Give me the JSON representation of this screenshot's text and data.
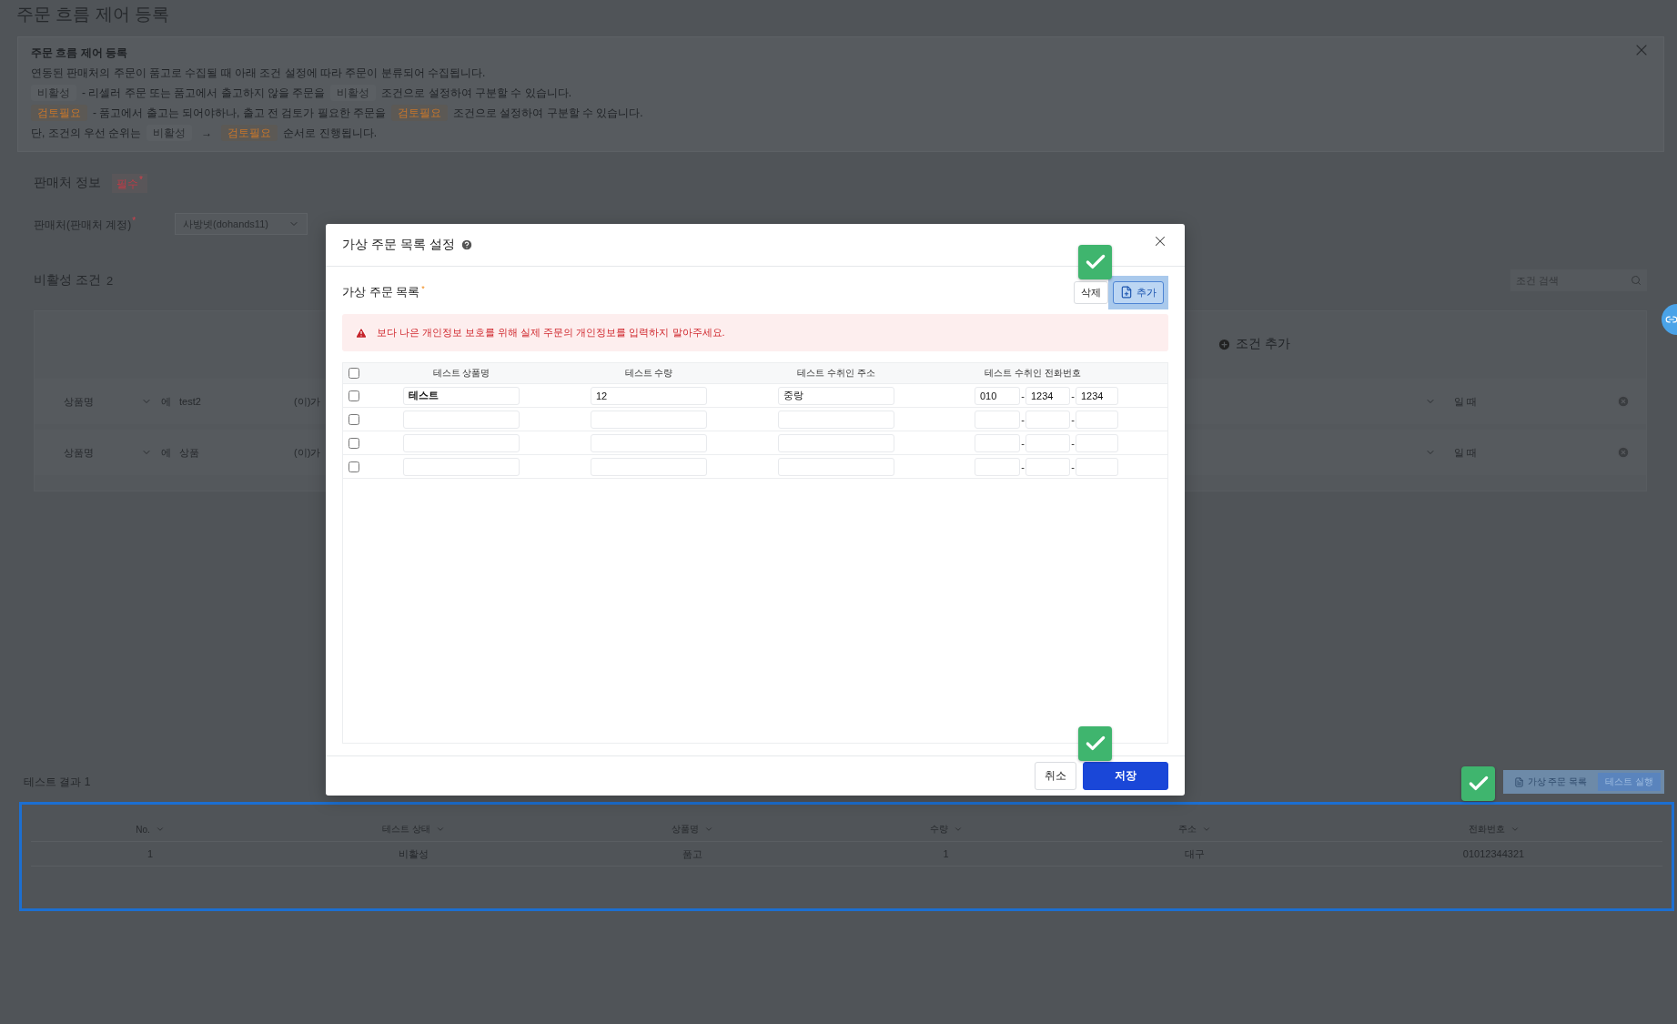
{
  "page": {
    "title": "주문 흐름 제어 등록"
  },
  "notice": {
    "title": "주문 흐름 제어 등록",
    "lines": [
      {
        "segments": [
          {
            "kind": "plain",
            "text": "연동된 판매처의 주문이 품고로 수집될 때 아래 조건 설정에 따라 주문이 분류되어 수집됩니다."
          }
        ]
      },
      {
        "segments": [
          {
            "kind": "inactive",
            "text": "비활성"
          },
          {
            "kind": "plain",
            "text": "- 리셀러 주문 또는 품고에서 출고하지 않을 주문을"
          },
          {
            "kind": "inactive",
            "text": "비활성"
          },
          {
            "kind": "plain",
            "text": "조건으로 설정하여 구분할 수 있습니다."
          }
        ]
      },
      {
        "segments": [
          {
            "kind": "review",
            "text": "검토필요"
          },
          {
            "kind": "plain",
            "text": "- 품고에서 출고는 되어야하나, 출고 전 검토가 필요한 주문을"
          },
          {
            "kind": "review",
            "text": "검토필요"
          },
          {
            "kind": "plain",
            "text": "조건으로 설정하여 구분할 수 있습니다."
          }
        ]
      },
      {
        "segments": [
          {
            "kind": "plain",
            "text": "단, 조건의 우선 순위는"
          },
          {
            "kind": "inactive",
            "text": "비활성"
          },
          {
            "kind": "arrow",
            "text": "→"
          },
          {
            "kind": "review",
            "text": "검토필요"
          },
          {
            "kind": "plain",
            "text": "순서로 진행됩니다."
          }
        ]
      }
    ]
  },
  "seller": {
    "heading": "판매처 정보",
    "badge": "필수",
    "badge_mark": "*",
    "field_label": "판매처(판매처 계정)",
    "required_mark": "*",
    "value": "사방넷(dohands11)"
  },
  "conditions": {
    "heading": "비활성 조건",
    "count": "2",
    "search_placeholder": "조건 검색",
    "add_label": "조건 추가",
    "rows": [
      {
        "field": "상품명",
        "particle": "에",
        "value": "test2",
        "suffix": "(이)가",
        "tail": "일 때"
      },
      {
        "field": "상품명",
        "particle": "에",
        "value": "상품",
        "suffix": "(이)가",
        "tail": "일 때"
      }
    ]
  },
  "test_result": {
    "heading": "테스트 결과",
    "count": "1",
    "buttons": [
      {
        "label": "가상 주문 목록",
        "kind": "secondary"
      },
      {
        "label": "테스트 실행",
        "kind": "primary"
      }
    ],
    "columns": [
      "No.",
      "테스트 상태",
      "상품명",
      "수량",
      "주소",
      "전화번호"
    ],
    "rows": [
      [
        "1",
        "비활성",
        "품고",
        "1",
        "대구",
        "01012344321"
      ]
    ]
  },
  "modal": {
    "title": "가상 주문 목록 설정",
    "section_title": "가상 주문 목록",
    "required_mark": "*",
    "actions": [
      {
        "label": "삭제",
        "kind": "plain"
      },
      {
        "label": "추가",
        "kind": "add"
      }
    ],
    "alert": "보다 나은 개인정보 보호를 위해 실제 주문의 개인정보를 입력하지 말아주세요.",
    "header_checked": false,
    "columns": [
      "테스트 상품명",
      "테스트 수량",
      "테스트 수취인 주소",
      "테스트 수취인 전화번호"
    ],
    "rows": [
      {
        "checked": false,
        "product": "테스트",
        "quantity": "12",
        "address": "중랑",
        "phone": [
          "010",
          "1234",
          "1234"
        ],
        "separators": [
          "-",
          "-"
        ]
      },
      {
        "checked": false,
        "separators": [
          "-",
          "-"
        ]
      },
      {
        "checked": false,
        "separators": [
          "-",
          "-"
        ]
      },
      {
        "checked": false,
        "separators": [
          "-",
          "-"
        ]
      }
    ],
    "footer_buttons": [
      {
        "label": "취소",
        "kind": "secondary"
      },
      {
        "label": "저장",
        "kind": "primary"
      }
    ]
  }
}
